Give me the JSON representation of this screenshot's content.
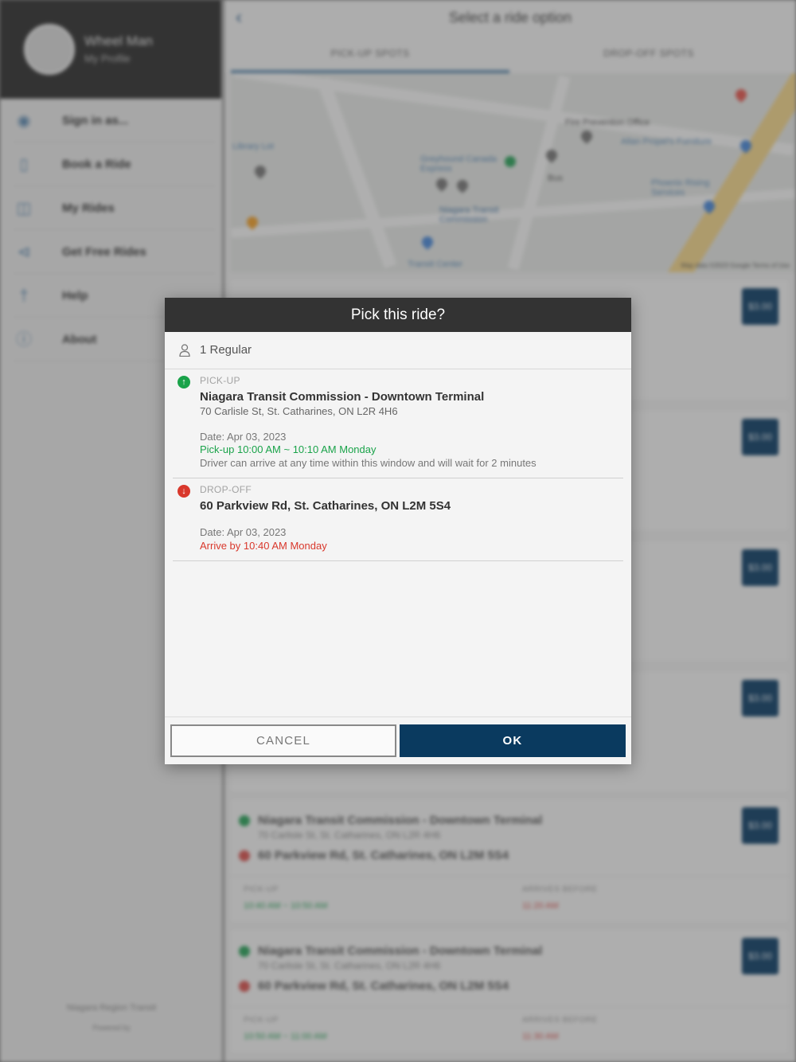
{
  "sidebar": {
    "profile_name": "Wheel Man",
    "profile_sub": "My Profile",
    "items": [
      {
        "label": "Sign in as...",
        "icon": "headset-icon"
      },
      {
        "label": "Book a Ride",
        "icon": "phone-icon"
      },
      {
        "label": "My Rides",
        "icon": "car-icon"
      },
      {
        "label": "Get Free Rides",
        "icon": "share-icon"
      },
      {
        "label": "Help",
        "icon": "help-icon"
      },
      {
        "label": "About",
        "icon": "info-icon"
      }
    ],
    "footer": "Niagara Region Transit",
    "footer_sub": "Powered by"
  },
  "header": {
    "title": "Select a ride option"
  },
  "tabs": [
    {
      "label": "PICK-UP SPOTS",
      "active": true
    },
    {
      "label": "DROP-OFF SPOTS",
      "active": false
    }
  ],
  "map": {
    "labels": [
      "Library Lot",
      "Greyhound Canada Express",
      "Niagara Transit Commission",
      "Transit Center",
      "Fire Prevention Office",
      "Allan Propel's Furniture",
      "Phoenix Rising Services",
      "Bus"
    ],
    "credit": "Map data ©2023 Google   Terms of Use"
  },
  "ride_cards": [
    {
      "price": "$3.00",
      "origin": "Niagara Transit Commission - Downtown Terminal",
      "origin_addr": "70 Carlisle St, St. Catharines, ON L2R 4H6",
      "destination": "60 Parkview Rd, St. Catharines, ON L2M 5S4",
      "pickup_label": "PICK-UP",
      "pickup_time": "10:40 AM ~ 10:50 AM",
      "arrive_label": "ARRIVES BEFORE",
      "arrive_time": "11:20 AM"
    },
    {
      "price": "$3.00",
      "origin": "Niagara Transit Commission - Downtown Terminal",
      "origin_addr": "70 Carlisle St, St. Catharines, ON L2R 4H6",
      "destination": "60 Parkview Rd, St. Catharines, ON L2M 5S4",
      "pickup_label": "PICK-UP",
      "pickup_time": "10:50 AM ~ 11:00 AM",
      "arrive_label": "ARRIVES BEFORE",
      "arrive_time": "11:30 AM"
    }
  ],
  "dialog": {
    "title": "Pick this ride?",
    "passengers": "1 Regular",
    "pickup": {
      "kind": "PICK-UP",
      "name": "Niagara Transit Commission - Downtown Terminal",
      "address": "70 Carlisle St, St. Catharines, ON L2R 4H6",
      "date": "Date: Apr 03, 2023",
      "window": "Pick-up 10:00 AM ~ 10:10 AM Monday",
      "note": "Driver can arrive at any time within this window and will wait for 2 minutes"
    },
    "dropoff": {
      "kind": "DROP-OFF",
      "name": "60 Parkview Rd, St. Catharines, ON L2M 5S4",
      "date": "Date: Apr 03, 2023",
      "window": "Arrive by 10:40 AM Monday"
    },
    "cancel_label": "CANCEL",
    "ok_label": "OK"
  },
  "colors": {
    "primary": "#0a3a5f",
    "pickup_green": "#1aa34a",
    "dropoff_red": "#d9382c",
    "header_dark": "#333333"
  }
}
